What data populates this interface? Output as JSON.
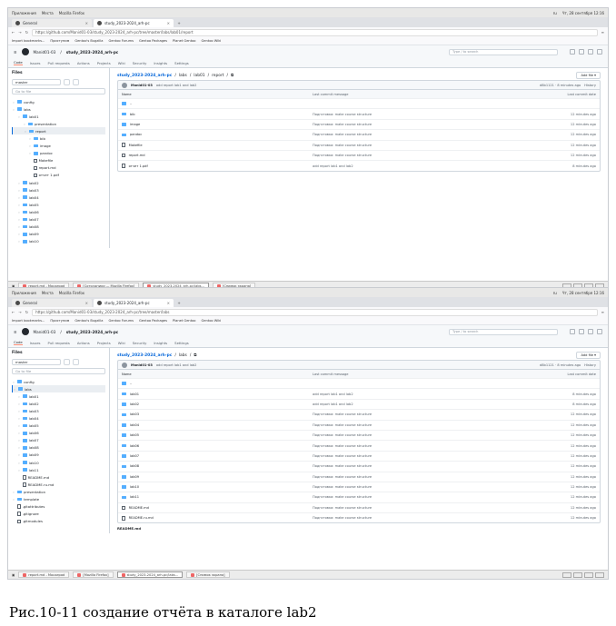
{
  "caption": "Рис.10-11 создание отчёта в каталоге lab2",
  "system_bar": {
    "apps": "Приложения",
    "places": "Места",
    "app_name": "Mozilla Firefox",
    "locale": "ru",
    "clock": "Чт, 28 сентября 12:16"
  },
  "screens": [
    {
      "browser": {
        "tabs": [
          "General",
          "study_2023-2024_arh-pc"
        ],
        "url": "https://github.com/Manid01-03/study_2023-2024_arh-pc/tree/master/labs/lab01/report",
        "bookmarks": [
          "Import bookmarks...",
          "Приступим",
          "Gentoo's Bugzilla",
          "Gentoo Forums",
          "Gentoo Packages",
          "Planet Gentoo",
          "Gentoo Wiki"
        ]
      },
      "github": {
        "owner": "Manid01-03",
        "repo": "study_2023-2024_arh-pc",
        "search_placeholder": "Type / to search",
        "nav": [
          "Code",
          "Issues",
          "Pull requests",
          "Actions",
          "Projects",
          "Wiki",
          "Security",
          "Insights",
          "Settings"
        ],
        "files_title": "Files",
        "branch": "master",
        "filter_placeholder": "Go to file",
        "breadcrumb": [
          "study_2023-2024_arh-pc",
          "labs",
          "lab01",
          "report"
        ],
        "add_file": "Add file",
        "commit_author": "Manid01-03",
        "commit_message": "add report lab1 and lab2",
        "commit_right": "d8b1121 · 8 minutes ago",
        "history": "History",
        "table_headers": [
          "Name",
          "Last commit message",
          "Last commit date"
        ],
        "rows": [
          {
            "name": "..",
            "kind": "folder",
            "msg": "",
            "date": ""
          },
          {
            "name": "bib",
            "kind": "folder",
            "msg": "Подготовка: make course structure",
            "date": "12 minutes ago"
          },
          {
            "name": "image",
            "kind": "folder",
            "msg": "Подготовка: make course structure",
            "date": "12 minutes ago"
          },
          {
            "name": "pandoc",
            "kind": "folder",
            "msg": "Подготовка: make course structure",
            "date": "12 minutes ago"
          },
          {
            "name": "Makefile",
            "kind": "file",
            "msg": "Подготовка: make course structure",
            "date": "12 minutes ago"
          },
          {
            "name": "report.md",
            "kind": "file",
            "msg": "Подготовка: make course structure",
            "date": "12 minutes ago"
          },
          {
            "name": "отчет 1.pdf",
            "kind": "file",
            "msg": "add report lab1 and lab2",
            "date": "8 minutes ago"
          }
        ],
        "tree": [
          {
            "label": "config",
            "kind": "folder",
            "depth": 0,
            "sel": false
          },
          {
            "label": "labs",
            "kind": "folder",
            "depth": 0,
            "sel": false
          },
          {
            "label": "lab01",
            "kind": "folder",
            "depth": 1,
            "sel": false
          },
          {
            "label": "presentation",
            "kind": "folder",
            "depth": 2,
            "sel": false
          },
          {
            "label": "report",
            "kind": "folder",
            "depth": 2,
            "sel": true
          },
          {
            "label": "bib",
            "kind": "folder",
            "depth": 3,
            "sel": false
          },
          {
            "label": "image",
            "kind": "folder",
            "depth": 3,
            "sel": false
          },
          {
            "label": "pandoc",
            "kind": "folder",
            "depth": 3,
            "sel": false
          },
          {
            "label": "Makefile",
            "kind": "file",
            "depth": 3,
            "sel": false
          },
          {
            "label": "report.md",
            "kind": "file",
            "depth": 3,
            "sel": false
          },
          {
            "label": "отчет 1.pdf",
            "kind": "file",
            "depth": 3,
            "sel": false
          },
          {
            "label": "lab02",
            "kind": "folder",
            "depth": 1,
            "sel": false
          },
          {
            "label": "lab03",
            "kind": "folder",
            "depth": 1,
            "sel": false
          },
          {
            "label": "lab04",
            "kind": "folder",
            "depth": 1,
            "sel": false
          },
          {
            "label": "lab05",
            "kind": "folder",
            "depth": 1,
            "sel": false
          },
          {
            "label": "lab06",
            "kind": "folder",
            "depth": 1,
            "sel": false
          },
          {
            "label": "lab07",
            "kind": "folder",
            "depth": 1,
            "sel": false
          },
          {
            "label": "lab08",
            "kind": "folder",
            "depth": 1,
            "sel": false
          },
          {
            "label": "lab09",
            "kind": "folder",
            "depth": 1,
            "sel": false
          },
          {
            "label": "lab10",
            "kind": "folder",
            "depth": 1,
            "sel": false
          }
        ]
      },
      "taskbar": [
        "report.md - Mousepad",
        "[Сотрудники — Mozilla Firefox]",
        "study_2023-2024_arh-pc/labs...",
        "[Снимок экрана]"
      ]
    },
    {
      "browser": {
        "tabs": [
          "General",
          "study_2023-2024_arh-pc"
        ],
        "url": "https://github.com/Manid01-03/study_2023-2024_arh-pc/tree/master/labs",
        "bookmarks": [
          "Import bookmarks...",
          "Приступим",
          "Gentoo's Bugzilla",
          "Gentoo Forums",
          "Gentoo Packages",
          "Planet Gentoo",
          "Gentoo Wiki"
        ]
      },
      "github": {
        "owner": "Manid01-03",
        "repo": "study_2023-2024_arh-pc",
        "search_placeholder": "Type / to search",
        "nav": [
          "Code",
          "Issues",
          "Pull requests",
          "Actions",
          "Projects",
          "Wiki",
          "Security",
          "Insights",
          "Settings"
        ],
        "files_title": "Files",
        "branch": "master",
        "filter_placeholder": "Go to file",
        "breadcrumb": [
          "study_2023-2024_arh-pc",
          "labs"
        ],
        "add_file": "Add file",
        "commit_author": "Manid01-03",
        "commit_message": "add report lab1 and lab2",
        "commit_right": "d8b1121 · 8 minutes ago",
        "history": "History",
        "table_headers": [
          "Name",
          "Last commit message",
          "Last commit date"
        ],
        "rows": [
          {
            "name": "..",
            "kind": "folder",
            "msg": "",
            "date": ""
          },
          {
            "name": "lab01",
            "kind": "folder",
            "msg": "add report lab1 and lab2",
            "date": "8 minutes ago"
          },
          {
            "name": "lab02",
            "kind": "folder",
            "msg": "add report lab1 and lab2",
            "date": "8 minutes ago"
          },
          {
            "name": "lab03",
            "kind": "folder",
            "msg": "Подготовка: make course structure",
            "date": "12 minutes ago"
          },
          {
            "name": "lab04",
            "kind": "folder",
            "msg": "Подготовка: make course structure",
            "date": "12 minutes ago"
          },
          {
            "name": "lab05",
            "kind": "folder",
            "msg": "Подготовка: make course structure",
            "date": "12 minutes ago"
          },
          {
            "name": "lab06",
            "kind": "folder",
            "msg": "Подготовка: make course structure",
            "date": "12 minutes ago"
          },
          {
            "name": "lab07",
            "kind": "folder",
            "msg": "Подготовка: make course structure",
            "date": "12 minutes ago"
          },
          {
            "name": "lab08",
            "kind": "folder",
            "msg": "Подготовка: make course structure",
            "date": "12 minutes ago"
          },
          {
            "name": "lab09",
            "kind": "folder",
            "msg": "Подготовка: make course structure",
            "date": "12 minutes ago"
          },
          {
            "name": "lab10",
            "kind": "folder",
            "msg": "Подготовка: make course structure",
            "date": "12 minutes ago"
          },
          {
            "name": "lab11",
            "kind": "folder",
            "msg": "Подготовка: make course structure",
            "date": "12 minutes ago"
          },
          {
            "name": "README.md",
            "kind": "file",
            "msg": "Подготовка: make course structure",
            "date": "12 minutes ago"
          },
          {
            "name": "README.ru.md",
            "kind": "file",
            "msg": "Подготовка: make course structure",
            "date": "12 minutes ago"
          }
        ],
        "readme_label": "README.md",
        "tree": [
          {
            "label": "config",
            "kind": "folder",
            "depth": 0,
            "sel": false
          },
          {
            "label": "labs",
            "kind": "folder",
            "depth": 0,
            "sel": true
          },
          {
            "label": "lab01",
            "kind": "folder",
            "depth": 1,
            "sel": false
          },
          {
            "label": "lab02",
            "kind": "folder",
            "depth": 1,
            "sel": false
          },
          {
            "label": "lab03",
            "kind": "folder",
            "depth": 1,
            "sel": false
          },
          {
            "label": "lab04",
            "kind": "folder",
            "depth": 1,
            "sel": false
          },
          {
            "label": "lab05",
            "kind": "folder",
            "depth": 1,
            "sel": false
          },
          {
            "label": "lab06",
            "kind": "folder",
            "depth": 1,
            "sel": false
          },
          {
            "label": "lab07",
            "kind": "folder",
            "depth": 1,
            "sel": false
          },
          {
            "label": "lab08",
            "kind": "folder",
            "depth": 1,
            "sel": false
          },
          {
            "label": "lab09",
            "kind": "folder",
            "depth": 1,
            "sel": false
          },
          {
            "label": "lab10",
            "kind": "folder",
            "depth": 1,
            "sel": false
          },
          {
            "label": "lab11",
            "kind": "folder",
            "depth": 1,
            "sel": false
          },
          {
            "label": "README.md",
            "kind": "file",
            "depth": 1,
            "sel": false
          },
          {
            "label": "README.ru.md",
            "kind": "file",
            "depth": 1,
            "sel": false
          },
          {
            "label": "presentation",
            "kind": "folder",
            "depth": 0,
            "sel": false
          },
          {
            "label": "template",
            "kind": "folder",
            "depth": 0,
            "sel": false
          },
          {
            "label": ".gitattributes",
            "kind": "file",
            "depth": 0,
            "sel": false
          },
          {
            "label": ".gitignore",
            "kind": "file",
            "depth": 0,
            "sel": false
          },
          {
            "label": ".gitmodules",
            "kind": "file",
            "depth": 0,
            "sel": false
          }
        ]
      },
      "taskbar": [
        "report.md - Mousepad",
        "[Mozilla Firefox]",
        "study_2023-2024_arh-pc/labs...",
        "[Снимок экрана]"
      ]
    }
  ]
}
